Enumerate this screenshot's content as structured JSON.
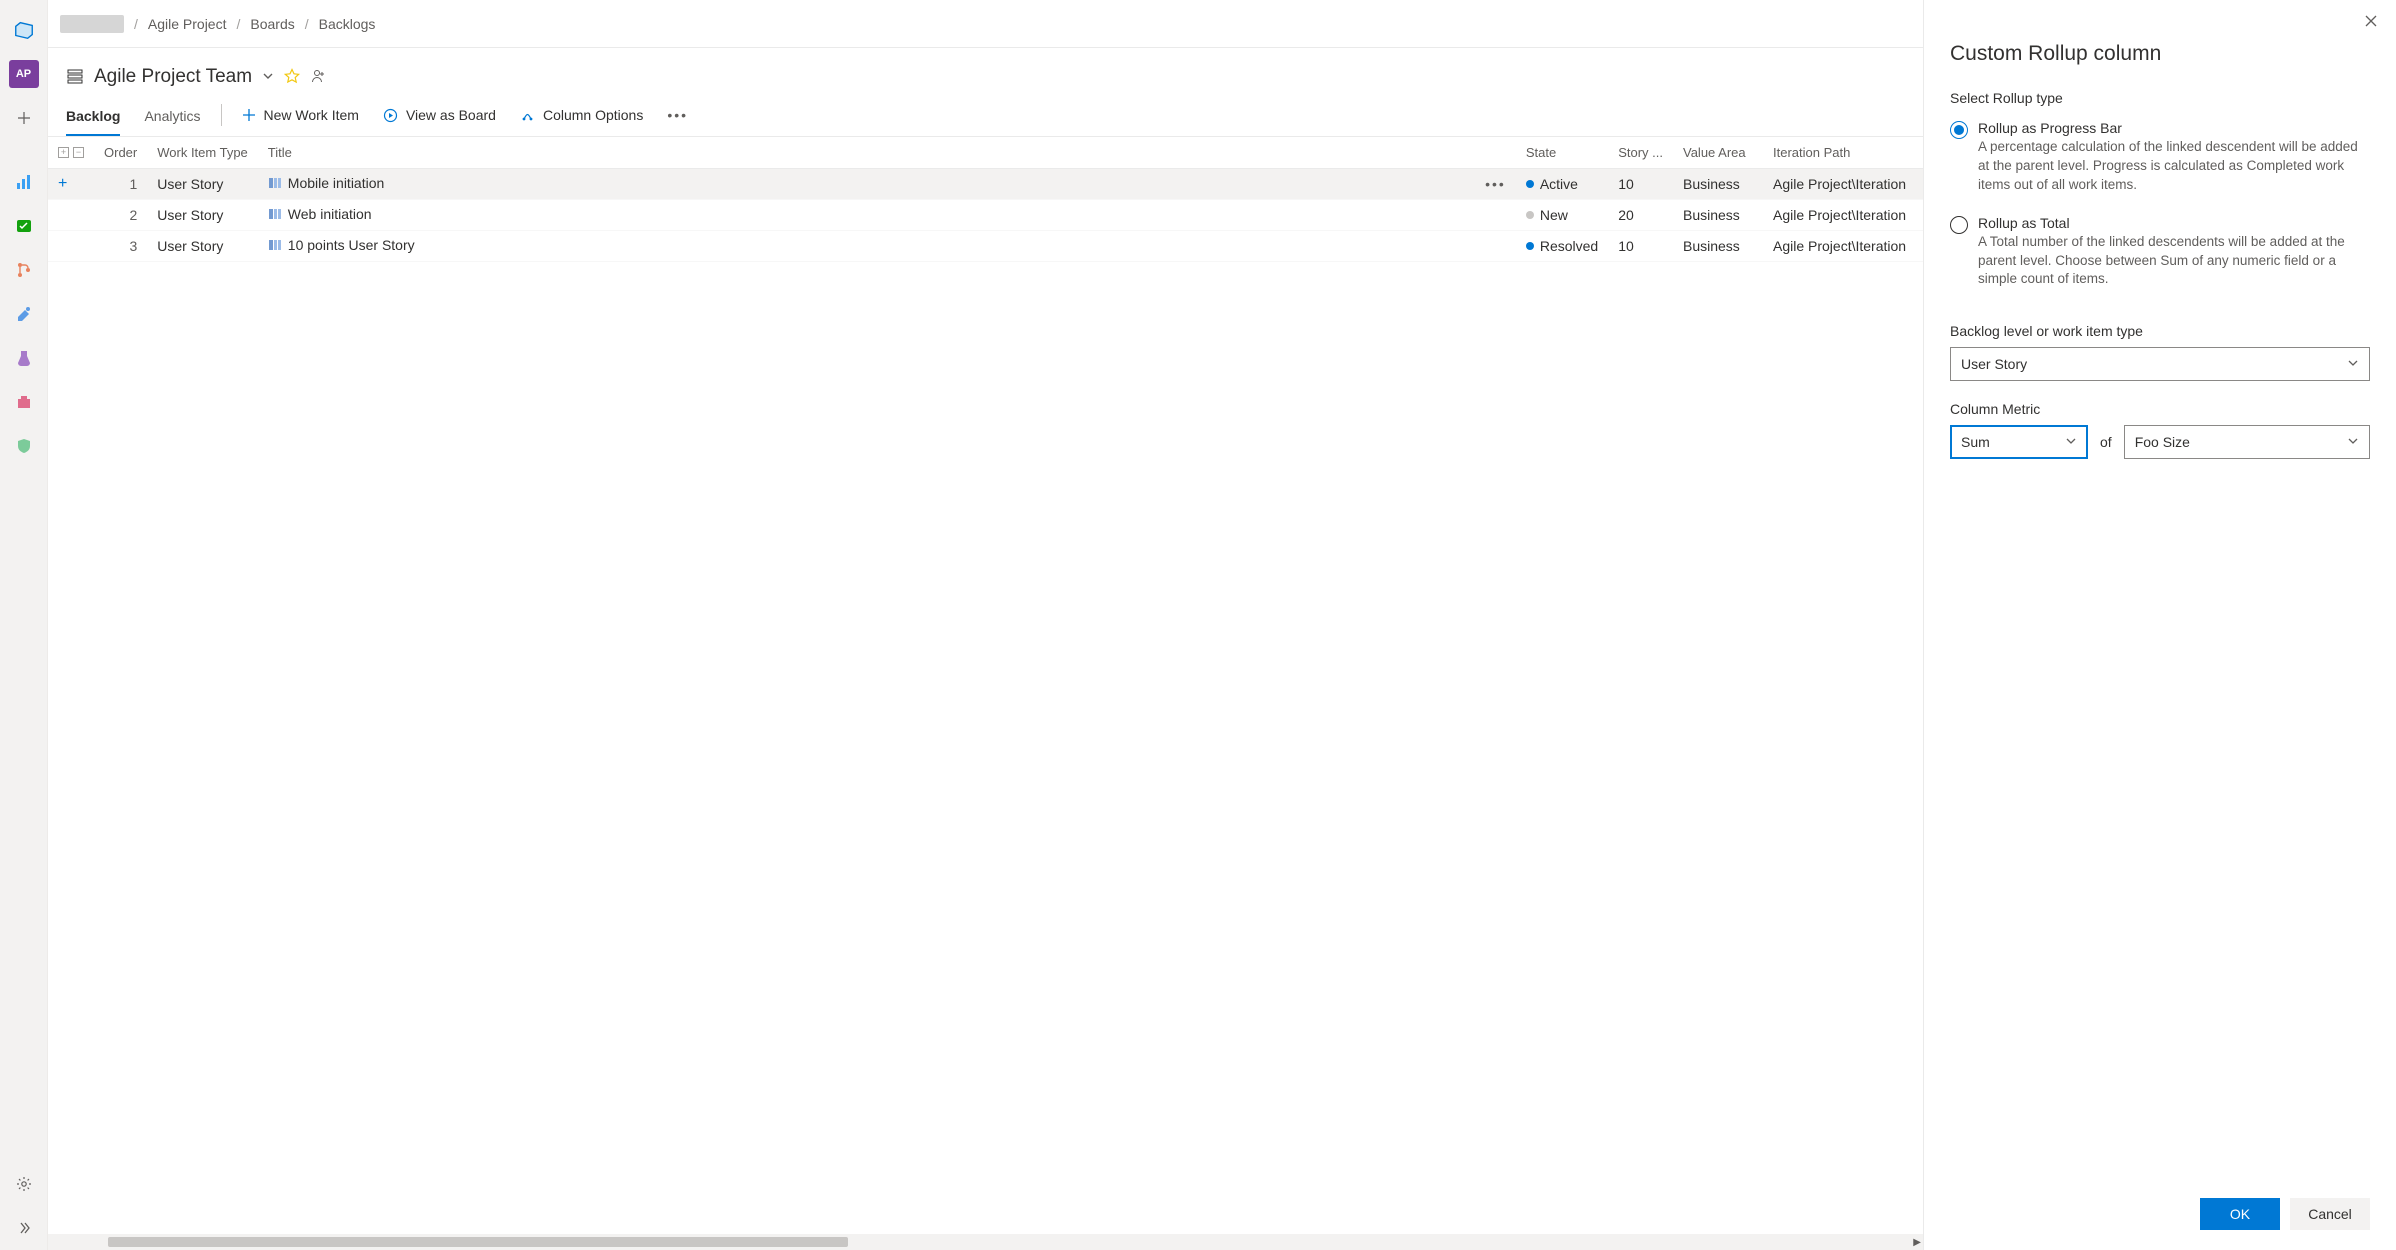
{
  "breadcrumb": {
    "project": "Agile Project",
    "section": "Boards",
    "page": "Backlogs"
  },
  "header": {
    "title": "Agile Project Team"
  },
  "tabs": {
    "backlog": "Backlog",
    "analytics": "Analytics"
  },
  "commands": {
    "newItem": "New Work Item",
    "viewBoard": "View as Board",
    "columnOptions": "Column Options"
  },
  "columns": {
    "order": "Order",
    "workItemType": "Work Item Type",
    "title": "Title",
    "state": "State",
    "story": "Story ...",
    "valueArea": "Value Area",
    "iteration": "Iteration Path"
  },
  "rows": [
    {
      "order": "1",
      "type": "User Story",
      "title": "Mobile initiation",
      "state": "Active",
      "stateClass": "dot-active",
      "story": "10",
      "valueArea": "Business",
      "iteration": "Agile Project\\Iteration",
      "hovered": true
    },
    {
      "order": "2",
      "type": "User Story",
      "title": "Web initiation",
      "state": "New",
      "stateClass": "dot-new",
      "story": "20",
      "valueArea": "Business",
      "iteration": "Agile Project\\Iteration",
      "hovered": false
    },
    {
      "order": "3",
      "type": "User Story",
      "title": "10 points User Story",
      "state": "Resolved",
      "stateClass": "dot-resolved",
      "story": "10",
      "valueArea": "Business",
      "iteration": "Agile Project\\Iteration",
      "hovered": false
    }
  ],
  "rail": {
    "avatar": "AP"
  },
  "panel": {
    "title": "Custom Rollup column",
    "rollupTypeLabel": "Select Rollup type",
    "option1": {
      "label": "Rollup as Progress Bar",
      "desc": "A percentage calculation of the linked descendent will be added at the parent level. Progress is calculated as Completed work items out of all work items."
    },
    "option2": {
      "label": "Rollup as Total",
      "desc": "A Total number of the linked descendents will be added at the parent level. Choose between Sum of any numeric field or a simple count of items."
    },
    "backlogLevelLabel": "Backlog level or work item type",
    "backlogLevelValue": "User Story",
    "columnMetricLabel": "Column Metric",
    "metricAgg": "Sum",
    "metricOf": "of",
    "metricField": "Foo Size",
    "ok": "OK",
    "cancel": "Cancel"
  }
}
